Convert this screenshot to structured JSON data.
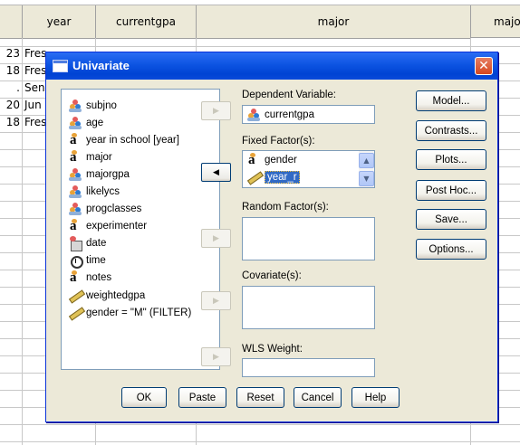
{
  "spreadsheet": {
    "top_fragment": "... ... ...",
    "columns": [
      "year",
      "currentgpa",
      "major",
      "majo"
    ],
    "rows": [
      {
        "num": "23",
        "year": "Fres"
      },
      {
        "num": "18",
        "year": "Fres"
      },
      {
        "num": ".",
        "year": "Sen"
      },
      {
        "num": "20",
        "year": "Jun"
      },
      {
        "num": "18",
        "year": "Fres"
      }
    ]
  },
  "dialog": {
    "title": "Univariate",
    "close_glyph": "✕",
    "variables": [
      {
        "label": "subjno",
        "icon": "ic-people"
      },
      {
        "label": "age",
        "icon": "ic-people"
      },
      {
        "label": "year in school [year]",
        "icon": "ic-string"
      },
      {
        "label": "major",
        "icon": "ic-string"
      },
      {
        "label": "majorgpa",
        "icon": "ic-people"
      },
      {
        "label": "likelycs",
        "icon": "ic-people"
      },
      {
        "label": "progclasses",
        "icon": "ic-people"
      },
      {
        "label": "experimenter",
        "icon": "ic-string"
      },
      {
        "label": "date",
        "icon": "ic-date"
      },
      {
        "label": "time",
        "icon": "ic-time"
      },
      {
        "label": "notes",
        "icon": "ic-string"
      },
      {
        "label": "weightedgpa",
        "icon": "ic-ruler"
      },
      {
        "label": "gender = \"M\" (FILTER)",
        "icon": "ic-ruler"
      }
    ],
    "dependent_label": "Dependent Variable:",
    "dependent_value": "currentgpa",
    "fixed_label": "Fixed Factor(s):",
    "fixed_items": [
      "gender",
      "year_r"
    ],
    "random_label": "Random Factor(s):",
    "covariate_label": "Covariate(s):",
    "wls_label": "WLS Weight:",
    "arrow_right": "▶",
    "arrow_left": "◀",
    "scroll_up": "▲",
    "scroll_down": "▼",
    "side_buttons": [
      "Model...",
      "Contrasts...",
      "Plots...",
      "Post Hoc...",
      "Save...",
      "Options..."
    ],
    "bottom_buttons": [
      "OK",
      "Paste",
      "Reset",
      "Cancel",
      "Help"
    ]
  }
}
